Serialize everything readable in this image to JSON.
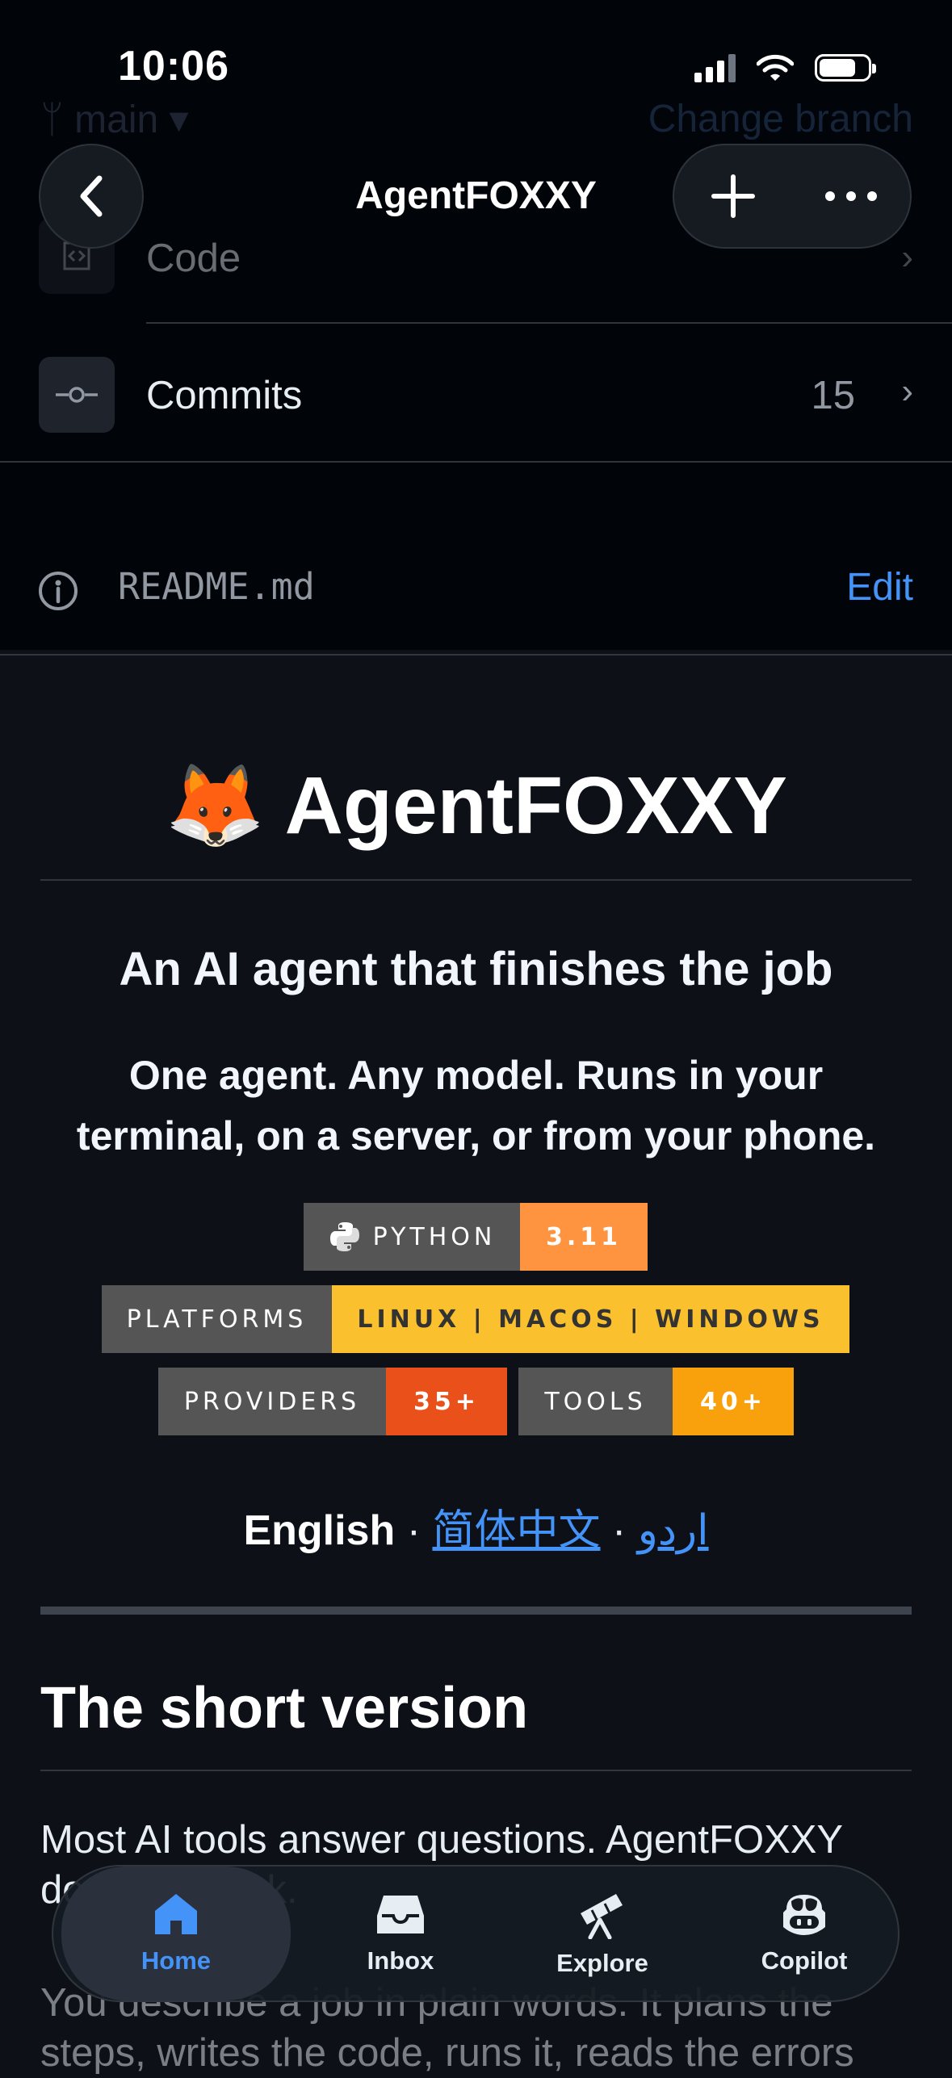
{
  "status_bar": {
    "time": "10:06"
  },
  "nav": {
    "title": "AgentFOXXY"
  },
  "hidden_header": {
    "branch_label": "main",
    "change_branch": "Change branch"
  },
  "rows": {
    "code": {
      "label": "Code"
    },
    "commits": {
      "label": "Commits",
      "count": "15"
    }
  },
  "readme": {
    "filename": "README.md",
    "edit_label": "Edit"
  },
  "content": {
    "emoji": "🦊",
    "title": "AgentFOXXY",
    "tagline": "An AI agent that finishes the job",
    "description": "One agent. Any model. Runs in your terminal, on a server, or from your phone.",
    "badges": [
      {
        "label": "PYTHON",
        "value": "3.11",
        "value_color": "#fe9440"
      },
      {
        "label": "PLATFORMS",
        "value": "LINUX | MACOS | WINDOWS",
        "value_color": "#fbc02d"
      },
      {
        "label": "PROVIDERS",
        "value": "35+",
        "value_color": "#e9501a"
      },
      {
        "label": "TOOLS",
        "value": "40+",
        "value_color": "#f9a10c"
      }
    ],
    "languages": {
      "current": "English",
      "sep": "·",
      "chinese": "简体中文",
      "urdu": "اردو"
    },
    "section_title": "The short version",
    "para1": "Most AI tools answer questions. AgentFOXXY does the work.",
    "para2": "You describe a job in plain words. It plans the steps, writes the code, runs it, reads the errors"
  },
  "tab_bar": {
    "home": "Home",
    "inbox": "Inbox",
    "explore": "Explore",
    "copilot": "Copilot"
  },
  "colors": {
    "accent": "#4493f8",
    "background": "#0d1117"
  }
}
